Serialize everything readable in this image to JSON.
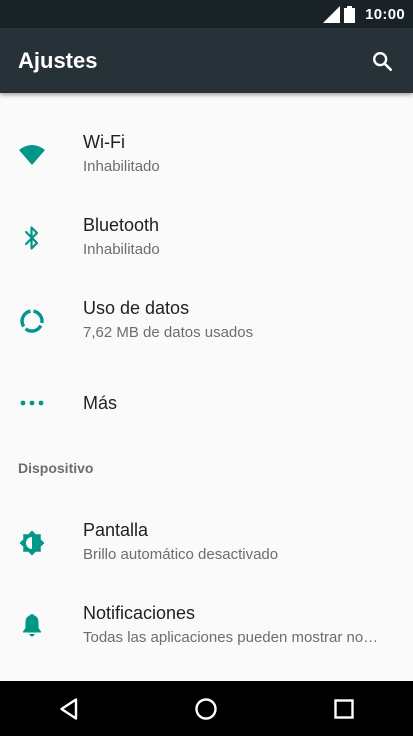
{
  "status_bar": {
    "time": "10:00"
  },
  "app_bar": {
    "title": "Ajustes"
  },
  "settings": [
    {
      "title": "Wi-Fi",
      "subtitle": "Inhabilitado",
      "icon": "wifi-icon"
    },
    {
      "title": "Bluetooth",
      "subtitle": "Inhabilitado",
      "icon": "bluetooth-icon"
    },
    {
      "title": "Uso de datos",
      "subtitle": "7,62 MB de datos usados",
      "icon": "data-usage-icon"
    },
    {
      "title": "Más",
      "icon": "more-icon"
    }
  ],
  "section_header": "Dispositivo",
  "device_settings": [
    {
      "title": "Pantalla",
      "subtitle": "Brillo automático desactivado",
      "icon": "brightness-icon"
    },
    {
      "title": "Notificaciones",
      "subtitle": "Todas las aplicaciones pueden mostrar no…",
      "icon": "bell-icon"
    }
  ],
  "colors": {
    "accent": "#009688",
    "app_bar": "#263238",
    "status_bar": "#192226",
    "nav_bar": "#000000"
  }
}
